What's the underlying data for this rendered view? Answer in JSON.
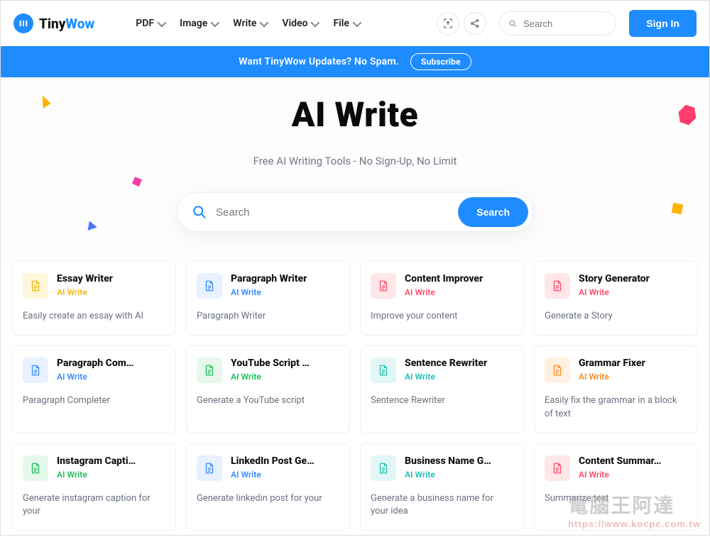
{
  "brand": {
    "name1": "Tiny",
    "name2": "Wow"
  },
  "nav": {
    "pdf": "PDF",
    "image": "Image",
    "write": "Write",
    "video": "Video",
    "file": "File"
  },
  "top_search": {
    "placeholder": "Search"
  },
  "signin": "Sign In",
  "banner": {
    "text": "Want TinyWow Updates? No Spam.",
    "button": "Subscribe"
  },
  "hero": {
    "title": "AI Write",
    "subtitle": "Free AI Writing Tools - No Sign-Up, No Limit",
    "search_placeholder": "Search",
    "search_button": "Search"
  },
  "category_label": "AI Write",
  "colors": {
    "yellow_bg": "#fff6da",
    "yellow": "#f2b90f",
    "blue_bg": "#e7efff",
    "blue": "#4b74ff",
    "red_bg": "#ffe6e9",
    "red": "#ff4d6a",
    "green_bg": "#e6f8ec",
    "green": "#1fbf5b",
    "teal_bg": "#e2f7f5",
    "teal": "#1fc1b6",
    "orange_bg": "#fff0e0",
    "orange": "#ff8a1f",
    "bluea_bg": "#e8f1ff",
    "bluea": "#3a8bff"
  },
  "cards": [
    {
      "title": "Essay Writer",
      "desc": "Easily create an essay with AI",
      "c": "yellow"
    },
    {
      "title": "Paragraph Writer",
      "desc": "Paragraph Writer",
      "c": "bluea"
    },
    {
      "title": "Content Improver",
      "desc": "Improve your content",
      "c": "red"
    },
    {
      "title": "Story Generator",
      "desc": "Generate a Story",
      "c": "red"
    },
    {
      "title": "Paragraph Com…",
      "desc": "Paragraph Completer",
      "c": "bluea"
    },
    {
      "title": "YouTube Script …",
      "desc": "Generate a YouTube script",
      "c": "green"
    },
    {
      "title": "Sentence Rewriter",
      "desc": "Sentence Rewriter",
      "c": "teal"
    },
    {
      "title": "Grammar Fixer",
      "desc": "Easily fix the grammar in a block of text",
      "c": "orange"
    },
    {
      "title": "Instagram Capti…",
      "desc": "Generate instagram caption for your",
      "c": "green"
    },
    {
      "title": "LinkedIn Post Ge…",
      "desc": "Generate linkedin post for your",
      "c": "bluea"
    },
    {
      "title": "Business Name G…",
      "desc": "Generate a business name for your idea",
      "c": "teal"
    },
    {
      "title": "Content Summar…",
      "desc": "Summarize text",
      "c": "red"
    }
  ],
  "watermark": {
    "main": "電腦王阿達",
    "sub": "https://www.kocpc.com.tw"
  }
}
